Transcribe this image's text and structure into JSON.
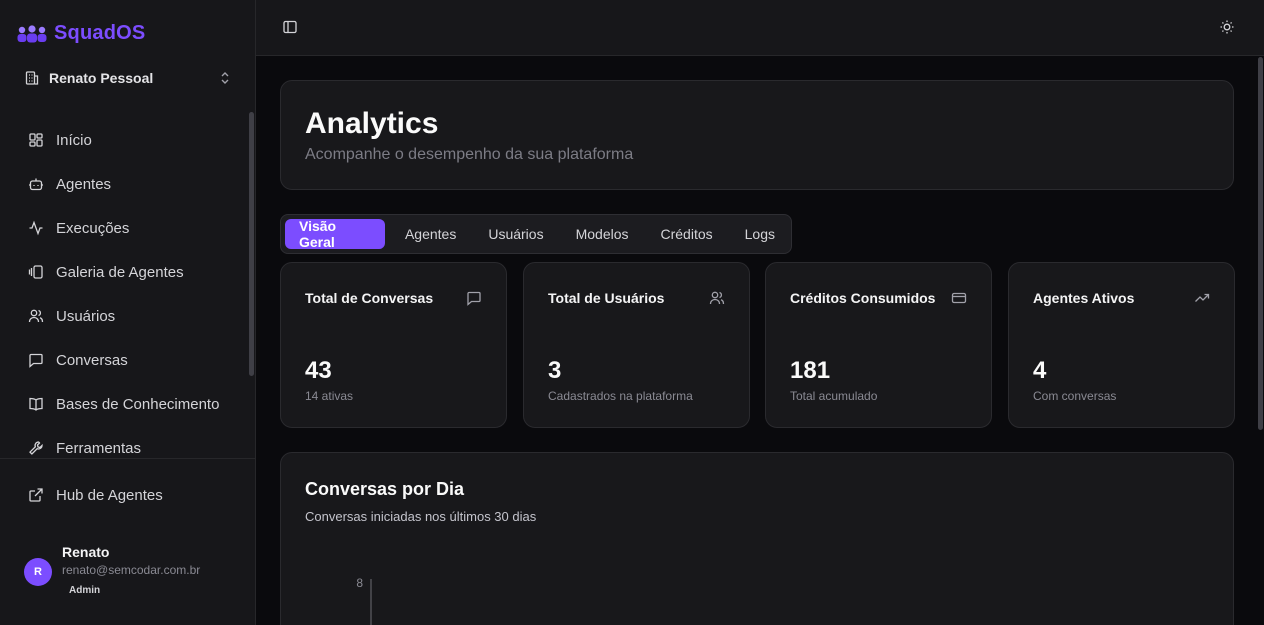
{
  "app": {
    "name": "SquadOS",
    "brand_color": "#7c4dff"
  },
  "workspace": {
    "name": "Renato Pessoal"
  },
  "sidebar": {
    "items": [
      {
        "label": "Início",
        "icon": "grid-icon"
      },
      {
        "label": "Agentes",
        "icon": "bot-icon"
      },
      {
        "label": "Execuções",
        "icon": "activity-icon"
      },
      {
        "label": "Galeria de Agentes",
        "icon": "gallery-icon"
      },
      {
        "label": "Usuários",
        "icon": "users-icon"
      },
      {
        "label": "Conversas",
        "icon": "message-icon"
      },
      {
        "label": "Bases de Conhecimento",
        "icon": "book-icon"
      },
      {
        "label": "Ferramentas",
        "icon": "wrench-icon"
      }
    ],
    "hub": {
      "label": "Hub de Agentes",
      "icon": "external-link-icon"
    }
  },
  "user": {
    "initial": "R",
    "name": "Renato",
    "email": "renato@semcodar.com.br",
    "role": "Admin"
  },
  "page": {
    "title": "Analytics",
    "subtitle": "Acompanhe o desempenho da sua plataforma"
  },
  "tabs": [
    {
      "label": "Visão Geral",
      "active": true
    },
    {
      "label": "Agentes"
    },
    {
      "label": "Usuários"
    },
    {
      "label": "Modelos"
    },
    {
      "label": "Créditos"
    },
    {
      "label": "Logs"
    }
  ],
  "stats": [
    {
      "title": "Total de Conversas",
      "value": "43",
      "sub": "14 ativas",
      "icon": "message-icon"
    },
    {
      "title": "Total de Usuários",
      "value": "3",
      "sub": "Cadastrados na plataforma",
      "icon": "users-icon"
    },
    {
      "title": "Créditos Consumidos",
      "value": "181",
      "sub": "Total acumulado",
      "icon": "credit-card-icon"
    },
    {
      "title": "Agentes Ativos",
      "value": "4",
      "sub": "Com conversas",
      "icon": "trending-up-icon"
    }
  ],
  "chart": {
    "title": "Conversas por Dia",
    "subtitle": "Conversas iniciadas nos últimos 30 dias"
  },
  "chart_data": {
    "type": "line",
    "title": "Conversas por Dia",
    "y_tick_labels": [
      "8"
    ],
    "x": [],
    "series": []
  }
}
